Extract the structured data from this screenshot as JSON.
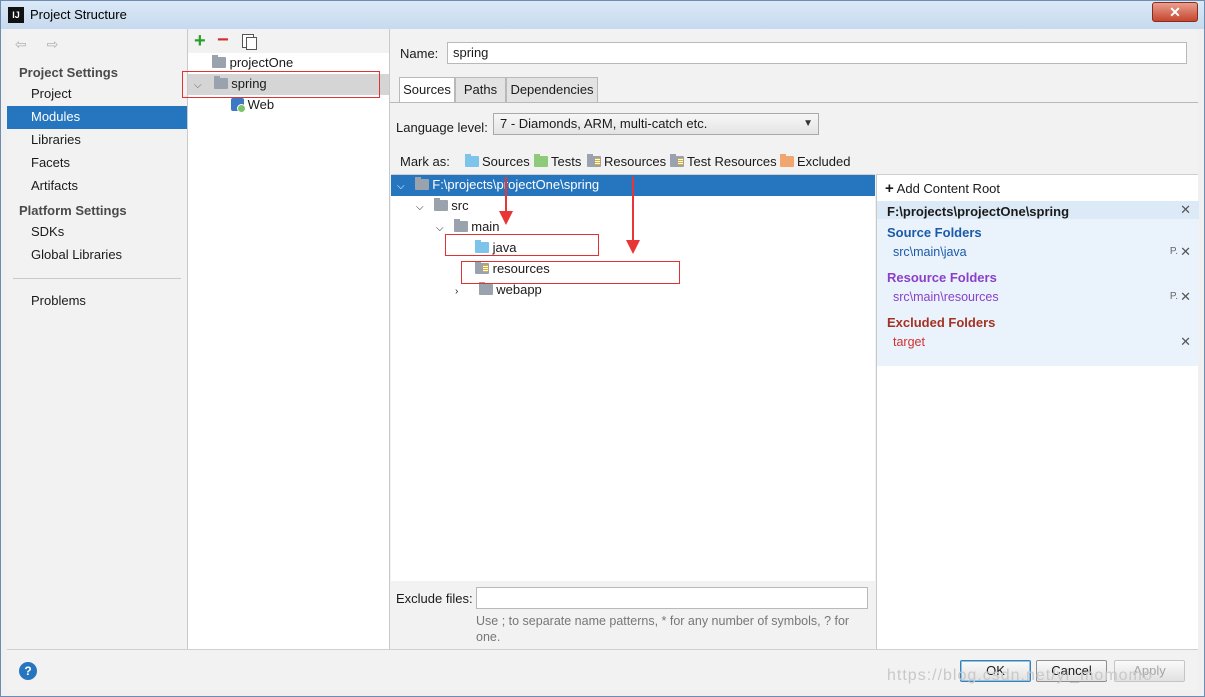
{
  "window": {
    "title": "Project Structure",
    "app_icon": "IJ",
    "close_glyph": "✕"
  },
  "nav": {
    "back_forward": "⇦ ⇨",
    "project_settings_header": "Project Settings",
    "project_settings_items": [
      "Project",
      "Modules",
      "Libraries",
      "Facets",
      "Artifacts"
    ],
    "platform_settings_header": "Platform Settings",
    "platform_settings_items": [
      "SDKs",
      "Global Libraries"
    ],
    "problems": "Problems",
    "selected": "Modules"
  },
  "modules": {
    "add_glyph": "+",
    "remove_glyph": "−",
    "items": [
      {
        "label": "projectOne"
      },
      {
        "label": "spring"
      },
      {
        "label": "Web"
      }
    ]
  },
  "module_detail": {
    "name_label": "Name:",
    "name_value": "spring",
    "tabs": [
      "Sources",
      "Paths",
      "Dependencies"
    ],
    "active_tab": "Sources",
    "language_level_label": "Language level:",
    "language_level_value": "7 - Diamonds, ARM, multi-catch etc.",
    "mark_as_label": "Mark as:",
    "mark_as": [
      "Sources",
      "Tests",
      "Resources",
      "Test Resources",
      "Excluded"
    ],
    "tree": [
      {
        "label": "F:\\projects\\projectOne\\spring"
      },
      {
        "label": "src"
      },
      {
        "label": "main"
      },
      {
        "label": "java"
      },
      {
        "label": "resources"
      },
      {
        "label": "webapp"
      }
    ],
    "exclude_files_label": "Exclude files:",
    "exclude_files_value": "",
    "exclude_hint": "Use ; to separate name patterns, * for any number of symbols, ? for one."
  },
  "content_roots": {
    "add_label": "Add Content Root",
    "root_path": "F:\\projects\\projectOne\\spring",
    "source_header": "Source Folders",
    "source_path": "src\\main\\java",
    "resource_header": "Resource Folders",
    "resource_path": "src\\main\\resources",
    "excluded_header": "Excluded Folders",
    "excluded_path": "target",
    "remove_glyph": "✕",
    "edit_glyph": "P."
  },
  "footer": {
    "help_glyph": "?",
    "ok": "OK",
    "cancel": "Cancel",
    "apply": "Apply",
    "watermark": "https://blog.csdn.net/yi_momomo"
  },
  "colors": {
    "selection": "#2675bf",
    "annotation": "#e03232",
    "source": "#1a5aa8",
    "resource": "#8a3fc9",
    "excluded": "#a33222"
  }
}
